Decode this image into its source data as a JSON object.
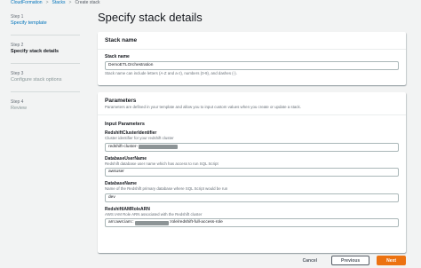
{
  "breadcrumb": [
    "CloudFormation",
    "Stacks",
    "Create stack"
  ],
  "steps": [
    {
      "num": "Step 1",
      "title": "Specify template",
      "state": "link"
    },
    {
      "num": "Step 2",
      "title": "Specify stack details",
      "state": "current"
    },
    {
      "num": "Step 3",
      "title": "Configure stack options",
      "state": "disabled"
    },
    {
      "num": "Step 4",
      "title": "Review",
      "state": "disabled"
    }
  ],
  "page_title": "Specify stack details",
  "stack_name": {
    "header": "Stack name",
    "label": "Stack name",
    "value": "DemoETLOrchestration",
    "constraint": "Stack name can include letters (A-Z and a-z), numbers (0-9), and dashes (-)."
  },
  "parameters": {
    "header": "Parameters",
    "description": "Parameters are defined in your template and allow you to input custom values when you create or update a stack.",
    "section_title": "Input Parameters",
    "fields": {
      "cluster": {
        "label": "RedshiftClusterIdentifier",
        "desc": "Cluster identifier for your redshift cluster",
        "value_prefix": "redshift-cluster-",
        "value_suffix": ""
      },
      "user": {
        "label": "DatabaseUserName",
        "desc": "Redshift database user name which has access to run SQL Script",
        "value": "awsuser"
      },
      "db": {
        "label": "DatabaseName",
        "desc": "Name of the Redshift primary database where SQL Script would be run",
        "value": "dev"
      },
      "role": {
        "label": "RedshiftIAMRoleARN",
        "desc": "AWS IAM Role ARN associated with the Redshift cluster",
        "value_prefix": "arn:aws:iam::",
        "value_suffix": ":role/redshift-full-access-role"
      }
    }
  },
  "footer": {
    "cancel": "Cancel",
    "previous": "Previous",
    "next": "Next"
  },
  "colors": {
    "primary": "#ec7211",
    "link": "#0073bb",
    "background": "#f2f3f3"
  }
}
